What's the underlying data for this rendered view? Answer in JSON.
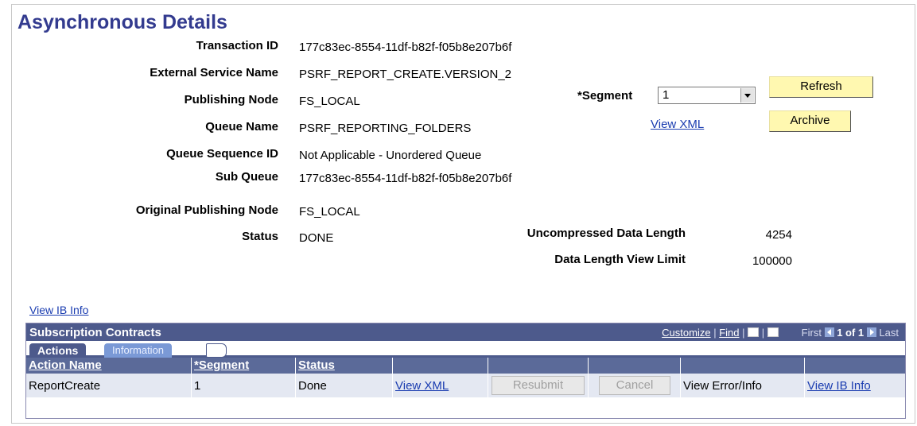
{
  "page_title": "Asynchronous Details",
  "details": [
    {
      "label": "Transaction ID",
      "value": "177c83ec-8554-11df-b82f-f05b8e207b6f"
    },
    {
      "label": "External Service Name",
      "value": "PSRF_REPORT_CREATE.VERSION_2"
    },
    {
      "label": "Publishing Node",
      "value": "FS_LOCAL"
    },
    {
      "label": "Queue Name",
      "value": "PSRF_REPORTING_FOLDERS"
    },
    {
      "label": "Queue Sequence ID",
      "value": "Not Applicable - Unordered Queue"
    },
    {
      "label": "Sub Queue",
      "value": "177c83ec-8554-11df-b82f-f05b8e207b6f"
    },
    {
      "label": "Original Publishing Node",
      "value": "FS_LOCAL"
    },
    {
      "label": "Status",
      "value": "DONE"
    }
  ],
  "segment": {
    "label": "*Segment",
    "value": "1"
  },
  "view_xml_link": "View XML",
  "buttons": {
    "refresh": "Refresh",
    "archive": "Archive"
  },
  "data_lengths": [
    {
      "label": "Uncompressed Data Length",
      "value": "4254"
    },
    {
      "label": "Data Length View Limit",
      "value": "100000"
    }
  ],
  "view_ib_info_link": "View IB Info",
  "grid": {
    "title": "Subscription Contracts",
    "customize": "Customize",
    "find": "Find",
    "first": "First",
    "page": "1 of 1",
    "last": "Last",
    "tabs": {
      "actions": "Actions",
      "information": "Information"
    },
    "columns": [
      "Action Name",
      "*Segment",
      "Status"
    ],
    "row": {
      "action_name": "ReportCreate",
      "segment": "1",
      "status": "Done",
      "view_xml": "View XML",
      "resubmit": "Resubmit",
      "cancel": "Cancel",
      "view_error": "View Error/Info",
      "view_ib_info": "View IB Info"
    }
  }
}
